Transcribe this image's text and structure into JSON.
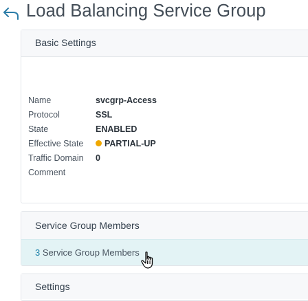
{
  "header": {
    "back_icon": "back-arrow-icon",
    "title": "Load Balancing Service Group"
  },
  "basic_settings": {
    "title": "Basic Settings",
    "rows": [
      {
        "key": "Name",
        "value": "svcgrp-Access"
      },
      {
        "key": "Protocol",
        "value": "SSL"
      },
      {
        "key": "State",
        "value": "ENABLED"
      },
      {
        "key": "Effective State",
        "value": "PARTIAL-UP",
        "status_color": "#f0a800"
      },
      {
        "key": "Traffic Domain",
        "value": "0"
      },
      {
        "key": "Comment",
        "value": ""
      }
    ]
  },
  "members": {
    "title": "Service Group Members",
    "count": "3",
    "link_text": "Service Group Members"
  },
  "settings": {
    "title": "Settings"
  },
  "colors": {
    "accent_link": "#1a7fa8",
    "highlight_row": "#e3f3f5",
    "status_partial_up": "#f0a800"
  }
}
